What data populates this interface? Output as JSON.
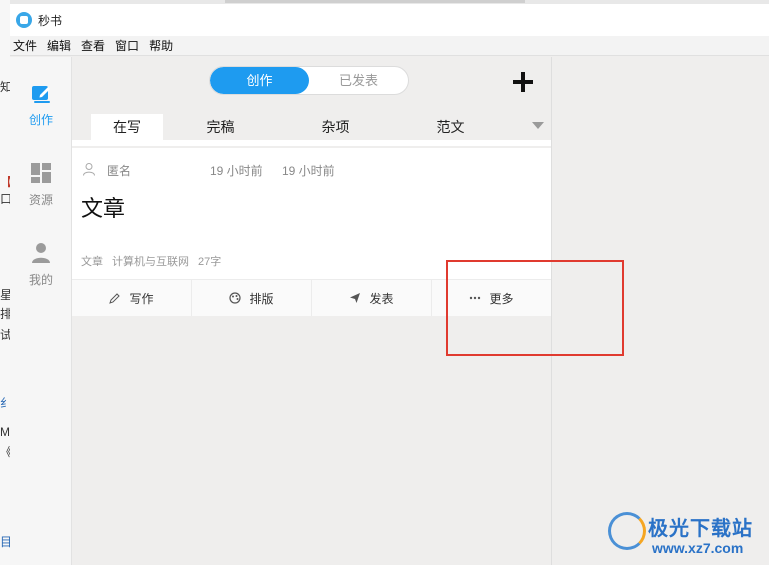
{
  "app": {
    "title": "秒书"
  },
  "menu": [
    "文件",
    "编辑",
    "查看",
    "窗口",
    "帮助"
  ],
  "sidebar": [
    {
      "label": "创作",
      "icon": "pencil-note-icon",
      "active": true
    },
    {
      "label": "资源",
      "icon": "grid-icon",
      "active": false
    },
    {
      "label": "我的",
      "icon": "user-icon",
      "active": false
    }
  ],
  "segment": {
    "create": "创作",
    "published": "已发表"
  },
  "tabs": [
    "在写",
    "完稿",
    "杂项",
    "范文"
  ],
  "article": {
    "author": "匿名",
    "created": "19 小时前",
    "modified": "19 小时前",
    "title": "文章",
    "meta": [
      "文章",
      "计算机与互联网",
      "27字"
    ]
  },
  "actions": [
    "写作",
    "排版",
    "发表",
    "更多"
  ],
  "watermark": {
    "name": "极光下载站",
    "url": "www.xz7.com"
  },
  "colors": {
    "accent": "#1e9bf0",
    "highlight": "#e03a2f"
  }
}
